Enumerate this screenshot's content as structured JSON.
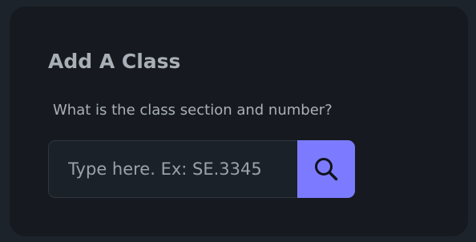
{
  "card": {
    "title": "Add A Class",
    "prompt": "What is the class section and number?"
  },
  "search": {
    "value": "",
    "placeholder": "Type here. Ex: SE.3345",
    "button_icon": "search-icon"
  },
  "colors": {
    "accent": "#7c7bff",
    "card_background": "#161a20",
    "page_background": "#1d232b"
  }
}
